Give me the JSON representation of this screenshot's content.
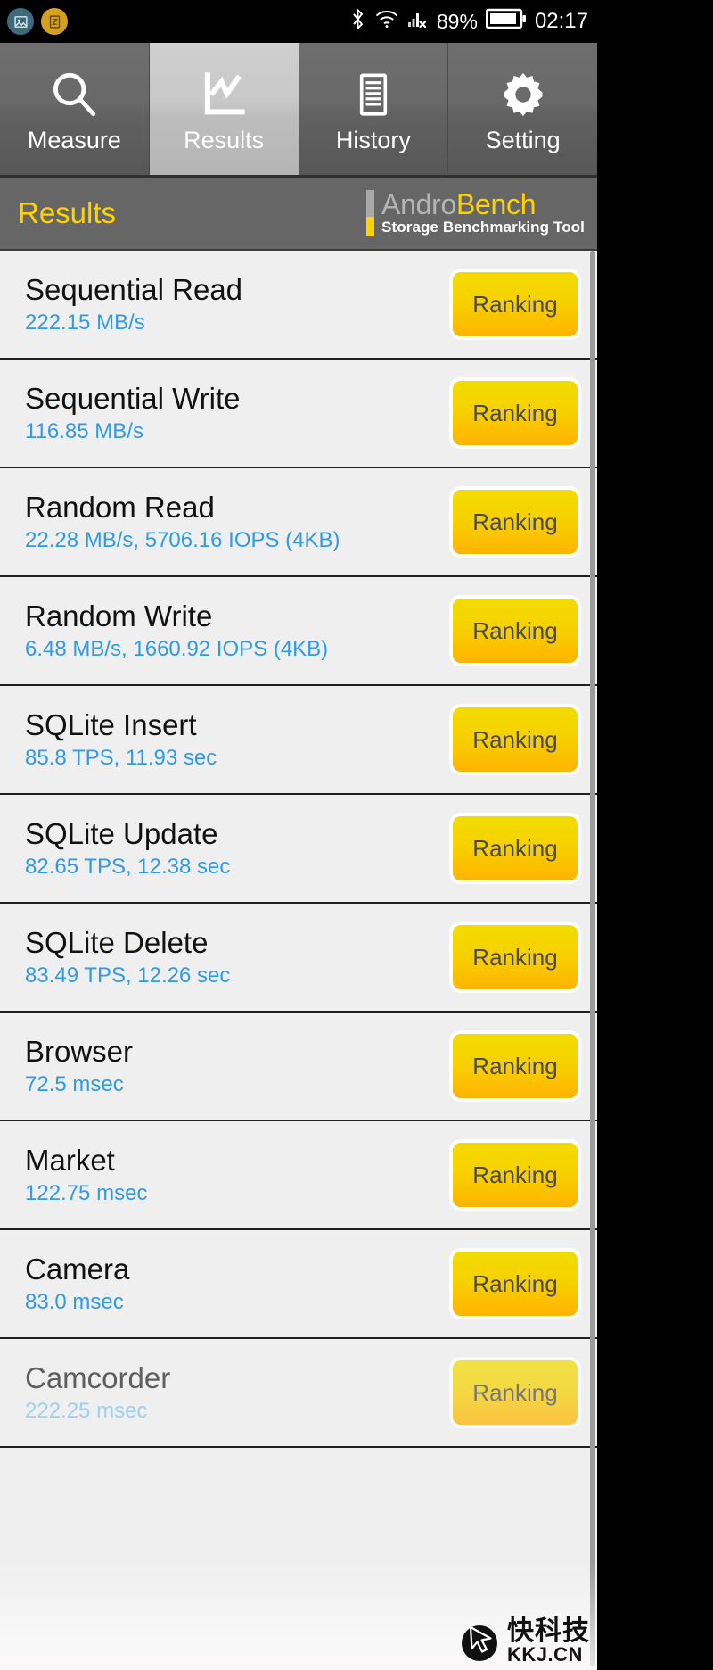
{
  "status_bar": {
    "notifications": [
      {
        "icon": "screenshot-notification-icon",
        "glyph": "⬚"
      },
      {
        "icon": "document-notification-icon",
        "glyph": "ⓢ"
      }
    ],
    "bluetooth_icon": "bluetooth-icon",
    "wifi_icon": "wifi-icon",
    "signal_icon": "signal-no-service-icon",
    "battery_percent": "89%",
    "battery_icon": "battery-icon",
    "clock": "02:17"
  },
  "tabs": [
    {
      "label": "Measure",
      "icon": "search-icon",
      "active": false
    },
    {
      "label": "Results",
      "icon": "chart-icon",
      "active": true
    },
    {
      "label": "History",
      "icon": "document-lines-icon",
      "active": false
    },
    {
      "label": "Setting",
      "icon": "gear-icon",
      "active": false
    }
  ],
  "header": {
    "title": "Results",
    "logo_andro": "Andro",
    "logo_bench": "Bench",
    "logo_subtitle": "Storage Benchmarking Tool"
  },
  "colors": {
    "accent_yellow": "#ffd200",
    "value_blue": "#2f9be8",
    "header_gray": "#666666",
    "row_bg": "#efefef"
  },
  "results": [
    {
      "name": "Sequential Read",
      "value": "222.15 MB/s",
      "button": "Ranking"
    },
    {
      "name": "Sequential Write",
      "value": "116.85 MB/s",
      "button": "Ranking"
    },
    {
      "name": "Random Read",
      "value": "22.28 MB/s, 5706.16 IOPS (4KB)",
      "button": "Ranking"
    },
    {
      "name": "Random Write",
      "value": "6.48 MB/s, 1660.92 IOPS (4KB)",
      "button": "Ranking"
    },
    {
      "name": "SQLite Insert",
      "value": "85.8 TPS, 11.93 sec",
      "button": "Ranking"
    },
    {
      "name": "SQLite Update",
      "value": "82.65 TPS, 12.38 sec",
      "button": "Ranking"
    },
    {
      "name": "SQLite Delete",
      "value": "83.49 TPS, 12.26 sec",
      "button": "Ranking"
    },
    {
      "name": "Browser",
      "value": "72.5 msec",
      "button": "Ranking"
    },
    {
      "name": "Market",
      "value": "122.75 msec",
      "button": "Ranking"
    },
    {
      "name": "Camera",
      "value": "83.0 msec",
      "button": "Ranking"
    },
    {
      "name": "Camcorder",
      "value": "222.25 msec",
      "button": "Ranking"
    }
  ],
  "watermark": {
    "cn_text": "快科技",
    "url_text": "KKJ.CN"
  }
}
